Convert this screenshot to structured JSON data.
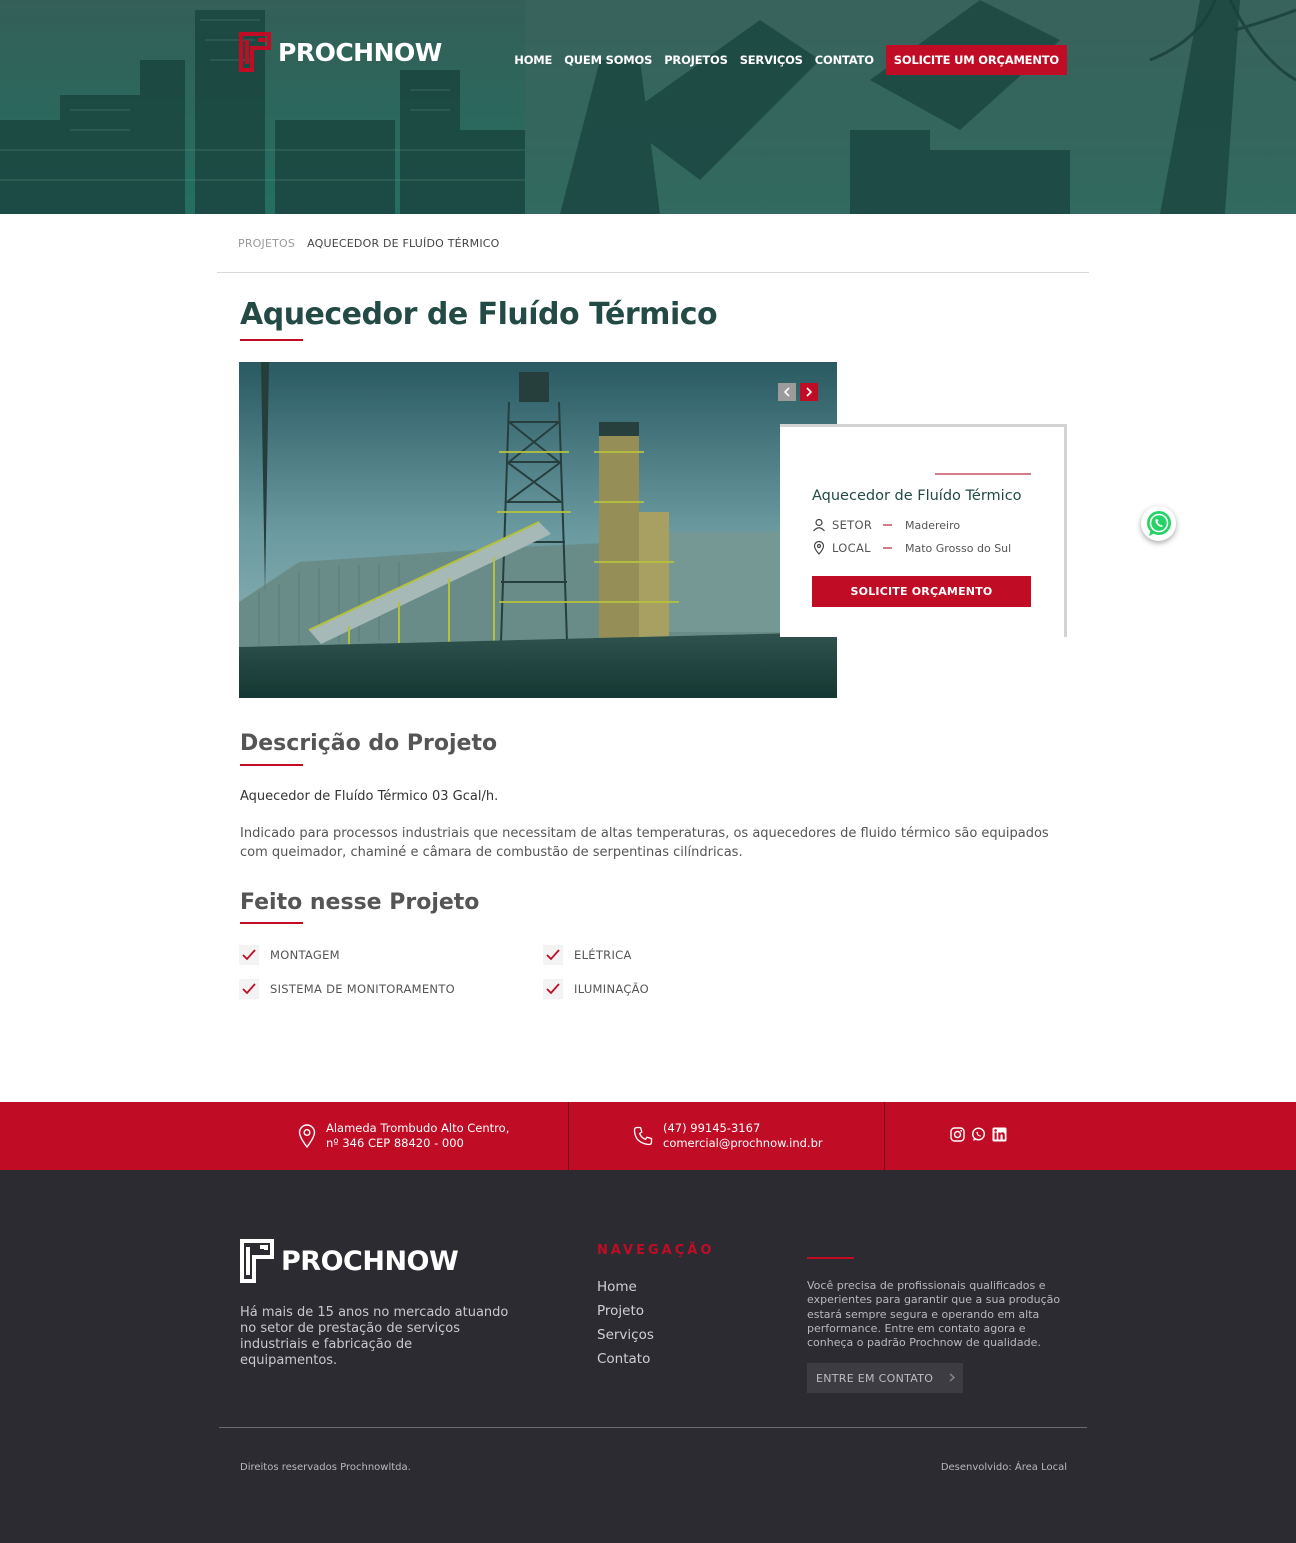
{
  "header": {
    "logo_text": "PROCHNOW",
    "nav": [
      {
        "label": "HOME"
      },
      {
        "label": "QUEM SOMOS"
      },
      {
        "label": "PROJETOS"
      },
      {
        "label": "SERVIÇOS"
      },
      {
        "label": "CONTATO"
      }
    ],
    "cta_label": "SOLICITE UM ORÇAMENTO"
  },
  "breadcrumb": {
    "parent": "PROJETOS",
    "current": "AQUECEDOR DE FLUÍDO TÉRMICO"
  },
  "page_title": "Aquecedor de Fluído Térmico",
  "slider": {
    "prev_icon": "chevron-left-icon",
    "next_icon": "chevron-right-icon"
  },
  "card": {
    "title": "Aquecedor de Fluído Térmico",
    "setor_label": "SETOR",
    "setor_value": "Madereiro",
    "local_label": "LOCAL",
    "local_value": "Mato Grosso do Sul",
    "cta_label": "SOLICITE ORÇAMENTO"
  },
  "description": {
    "title": "Descrição do Projeto",
    "lead": "Aquecedor de Fluído Térmico 03 Gcal/h.",
    "body": "Indicado para processos industriais que necessitam de altas temperaturas, os aquecedores de fluido térmico são equipados com queimador, chaminé e câmara de combustão de serpentinas cilíndricas."
  },
  "done": {
    "title": "Feito nesse Projeto",
    "items": [
      "MONTAGEM",
      "ELÉTRICA",
      "SISTEMA DE MONITORAMENTO",
      "ILUMINAÇÃO"
    ]
  },
  "contact_bar": {
    "address_line1": "Alameda Trombudo Alto Centro,",
    "address_line2": "nº 346 CEP 88420 - 000",
    "phone": "(47) 99145-3167",
    "email": "comercial@prochnow.ind.br",
    "socials": [
      "instagram-icon",
      "whatsapp-icon",
      "linkedin-icon"
    ]
  },
  "footer": {
    "logo_text": "PROCHNOW",
    "tagline": "Há mais de 15 anos no mercado atuando no setor de prestação de serviços industriais e fabricação de equipamentos.",
    "nav_title": "NAVEGAÇÃO",
    "nav": [
      {
        "label": "Home"
      },
      {
        "label": "Projeto"
      },
      {
        "label": "Serviços"
      },
      {
        "label": "Contato"
      }
    ],
    "text": "Você precisa de profissionais qualificados e experientes para garantir que a sua produção estará sempre segura e operando em alta performance. Entre em contato agora e conheça o padrão Prochnow de qualidade.",
    "button_label": "ENTRE EM CONTATO",
    "copyright": "Direitos reservados Prochnowltda.",
    "developer": "Desenvolvido: Área Local"
  },
  "colors": {
    "brand_red": "#c10c26",
    "teal_dark": "#234a45",
    "footer_bg": "#2c2b31"
  }
}
